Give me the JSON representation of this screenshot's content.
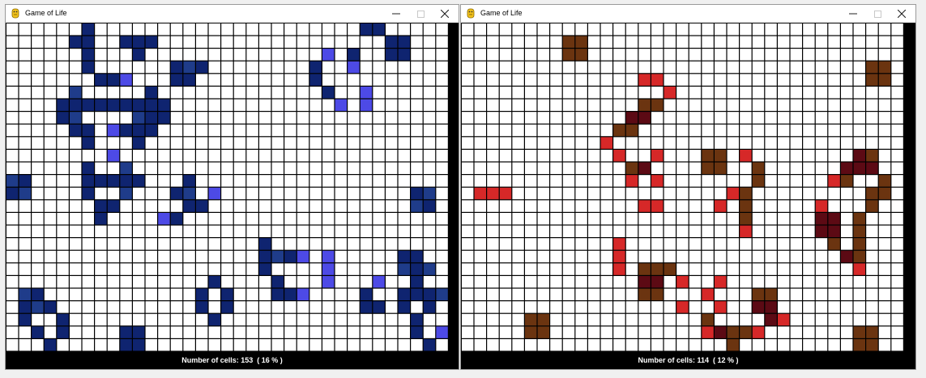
{
  "windows": [
    {
      "title": "Game of Life",
      "status": {
        "label": "Number of cells: ",
        "count": "153",
        "percent": "  ( 16 % )"
      },
      "colors": {
        "light": "#4d4ae6",
        "mid": "#1f3c8a",
        "dark": "#0f2470",
        "empty": "#ffffff",
        "gridline": "#000000"
      },
      "cells": [
        [
          6,
          0,
          "d"
        ],
        [
          28,
          0,
          "d"
        ],
        [
          29,
          0,
          "d"
        ],
        [
          5,
          1,
          "d"
        ],
        [
          6,
          1,
          "d"
        ],
        [
          9,
          1,
          "d"
        ],
        [
          10,
          1,
          "d"
        ],
        [
          11,
          1,
          "d"
        ],
        [
          30,
          1,
          "d"
        ],
        [
          31,
          1,
          "d"
        ],
        [
          6,
          2,
          "d"
        ],
        [
          10,
          2,
          "d"
        ],
        [
          25,
          2,
          "l"
        ],
        [
          27,
          2,
          "d"
        ],
        [
          30,
          2,
          "d"
        ],
        [
          31,
          2,
          "d"
        ],
        [
          6,
          3,
          "d"
        ],
        [
          13,
          3,
          "d"
        ],
        [
          14,
          3,
          "m"
        ],
        [
          15,
          3,
          "d"
        ],
        [
          24,
          3,
          "d"
        ],
        [
          27,
          3,
          "l"
        ],
        [
          7,
          4,
          "d"
        ],
        [
          8,
          4,
          "d"
        ],
        [
          9,
          4,
          "l"
        ],
        [
          13,
          4,
          "d"
        ],
        [
          14,
          4,
          "d"
        ],
        [
          24,
          4,
          "d"
        ],
        [
          5,
          5,
          "m"
        ],
        [
          11,
          5,
          "d"
        ],
        [
          25,
          5,
          "d"
        ],
        [
          28,
          5,
          "l"
        ],
        [
          4,
          6,
          "d"
        ],
        [
          5,
          6,
          "d"
        ],
        [
          6,
          6,
          "d"
        ],
        [
          7,
          6,
          "d"
        ],
        [
          8,
          6,
          "d"
        ],
        [
          9,
          6,
          "d"
        ],
        [
          10,
          6,
          "d"
        ],
        [
          11,
          6,
          "d"
        ],
        [
          12,
          6,
          "d"
        ],
        [
          26,
          6,
          "l"
        ],
        [
          28,
          6,
          "l"
        ],
        [
          4,
          7,
          "d"
        ],
        [
          5,
          7,
          "m"
        ],
        [
          10,
          7,
          "m"
        ],
        [
          11,
          7,
          "d"
        ],
        [
          12,
          7,
          "d"
        ],
        [
          5,
          8,
          "d"
        ],
        [
          6,
          8,
          "d"
        ],
        [
          8,
          8,
          "l"
        ],
        [
          9,
          8,
          "d"
        ],
        [
          10,
          8,
          "d"
        ],
        [
          11,
          8,
          "d"
        ],
        [
          6,
          9,
          "d"
        ],
        [
          10,
          9,
          "d"
        ],
        [
          8,
          10,
          "l"
        ],
        [
          6,
          11,
          "d"
        ],
        [
          9,
          11,
          "m"
        ],
        [
          0,
          12,
          "m"
        ],
        [
          1,
          12,
          "d"
        ],
        [
          6,
          12,
          "d"
        ],
        [
          7,
          12,
          "d"
        ],
        [
          8,
          12,
          "d"
        ],
        [
          9,
          12,
          "d"
        ],
        [
          10,
          12,
          "d"
        ],
        [
          14,
          12,
          "d"
        ],
        [
          0,
          13,
          "d"
        ],
        [
          1,
          13,
          "m"
        ],
        [
          6,
          13,
          "d"
        ],
        [
          9,
          13,
          "m"
        ],
        [
          13,
          13,
          "d"
        ],
        [
          14,
          13,
          "m"
        ],
        [
          16,
          13,
          "l"
        ],
        [
          32,
          13,
          "d"
        ],
        [
          33,
          13,
          "m"
        ],
        [
          7,
          14,
          "d"
        ],
        [
          8,
          14,
          "d"
        ],
        [
          14,
          14,
          "d"
        ],
        [
          15,
          14,
          "d"
        ],
        [
          32,
          14,
          "m"
        ],
        [
          33,
          14,
          "d"
        ],
        [
          7,
          15,
          "d"
        ],
        [
          12,
          15,
          "l"
        ],
        [
          13,
          15,
          "d"
        ],
        [
          20,
          17,
          "d"
        ],
        [
          20,
          18,
          "d"
        ],
        [
          21,
          18,
          "m"
        ],
        [
          22,
          18,
          "d"
        ],
        [
          23,
          18,
          "l"
        ],
        [
          25,
          18,
          "l"
        ],
        [
          31,
          18,
          "d"
        ],
        [
          32,
          18,
          "d"
        ],
        [
          20,
          19,
          "d"
        ],
        [
          25,
          19,
          "l"
        ],
        [
          31,
          19,
          "m"
        ],
        [
          32,
          19,
          "d"
        ],
        [
          33,
          19,
          "m"
        ],
        [
          16,
          20,
          "d"
        ],
        [
          21,
          20,
          "d"
        ],
        [
          25,
          20,
          "l"
        ],
        [
          29,
          20,
          "l"
        ],
        [
          32,
          20,
          "d"
        ],
        [
          1,
          21,
          "m"
        ],
        [
          2,
          21,
          "d"
        ],
        [
          15,
          21,
          "d"
        ],
        [
          17,
          21,
          "d"
        ],
        [
          21,
          21,
          "d"
        ],
        [
          22,
          21,
          "d"
        ],
        [
          23,
          21,
          "l"
        ],
        [
          28,
          21,
          "d"
        ],
        [
          31,
          21,
          "d"
        ],
        [
          32,
          21,
          "d"
        ],
        [
          33,
          21,
          "d"
        ],
        [
          34,
          21,
          "m"
        ],
        [
          1,
          22,
          "d"
        ],
        [
          2,
          22,
          "m"
        ],
        [
          3,
          22,
          "d"
        ],
        [
          15,
          22,
          "d"
        ],
        [
          17,
          22,
          "d"
        ],
        [
          28,
          22,
          "d"
        ],
        [
          29,
          22,
          "d"
        ],
        [
          31,
          22,
          "d"
        ],
        [
          33,
          22,
          "d"
        ],
        [
          1,
          23,
          "d"
        ],
        [
          4,
          23,
          "d"
        ],
        [
          16,
          23,
          "d"
        ],
        [
          32,
          23,
          "d"
        ],
        [
          2,
          24,
          "d"
        ],
        [
          4,
          24,
          "d"
        ],
        [
          9,
          24,
          "d"
        ],
        [
          10,
          24,
          "d"
        ],
        [
          32,
          24,
          "d"
        ],
        [
          34,
          24,
          "l"
        ],
        [
          3,
          25,
          "d"
        ],
        [
          9,
          25,
          "d"
        ],
        [
          10,
          25,
          "d"
        ],
        [
          33,
          25,
          "d"
        ]
      ]
    },
    {
      "title": "Game of Life",
      "status": {
        "label": "Number of cells: ",
        "count": "114",
        "percent": "  ( 12 % )"
      },
      "colors": {
        "light": "#d62828",
        "mid": "#6b3410",
        "dark": "#5c0a14",
        "empty": "#ffffff",
        "gridline": "#000000"
      },
      "cells": [
        [
          8,
          1,
          "m"
        ],
        [
          9,
          1,
          "m"
        ],
        [
          8,
          2,
          "m"
        ],
        [
          9,
          2,
          "m"
        ],
        [
          32,
          3,
          "m"
        ],
        [
          33,
          3,
          "m"
        ],
        [
          14,
          4,
          "l"
        ],
        [
          15,
          4,
          "l"
        ],
        [
          32,
          4,
          "m"
        ],
        [
          33,
          4,
          "m"
        ],
        [
          16,
          5,
          "l"
        ],
        [
          14,
          6,
          "m"
        ],
        [
          15,
          6,
          "m"
        ],
        [
          13,
          7,
          "d"
        ],
        [
          14,
          7,
          "d"
        ],
        [
          12,
          8,
          "m"
        ],
        [
          13,
          8,
          "m"
        ],
        [
          11,
          9,
          "l"
        ],
        [
          12,
          10,
          "l"
        ],
        [
          15,
          10,
          "l"
        ],
        [
          19,
          10,
          "m"
        ],
        [
          20,
          10,
          "m"
        ],
        [
          22,
          10,
          "l"
        ],
        [
          31,
          10,
          "d"
        ],
        [
          32,
          10,
          "m"
        ],
        [
          13,
          11,
          "m"
        ],
        [
          14,
          11,
          "d"
        ],
        [
          19,
          11,
          "m"
        ],
        [
          20,
          11,
          "m"
        ],
        [
          23,
          11,
          "m"
        ],
        [
          30,
          11,
          "d"
        ],
        [
          31,
          11,
          "d"
        ],
        [
          32,
          11,
          "d"
        ],
        [
          13,
          12,
          "l"
        ],
        [
          15,
          12,
          "l"
        ],
        [
          23,
          12,
          "m"
        ],
        [
          29,
          12,
          "l"
        ],
        [
          30,
          12,
          "m"
        ],
        [
          33,
          12,
          "m"
        ],
        [
          1,
          13,
          "l"
        ],
        [
          2,
          13,
          "l"
        ],
        [
          3,
          13,
          "l"
        ],
        [
          21,
          13,
          "l"
        ],
        [
          22,
          13,
          "m"
        ],
        [
          32,
          13,
          "m"
        ],
        [
          33,
          13,
          "m"
        ],
        [
          14,
          14,
          "l"
        ],
        [
          15,
          14,
          "l"
        ],
        [
          20,
          14,
          "l"
        ],
        [
          22,
          14,
          "m"
        ],
        [
          28,
          14,
          "l"
        ],
        [
          32,
          14,
          "m"
        ],
        [
          22,
          15,
          "m"
        ],
        [
          28,
          15,
          "d"
        ],
        [
          29,
          15,
          "d"
        ],
        [
          31,
          15,
          "m"
        ],
        [
          22,
          16,
          "l"
        ],
        [
          28,
          16,
          "d"
        ],
        [
          29,
          16,
          "d"
        ],
        [
          31,
          16,
          "m"
        ],
        [
          12,
          17,
          "l"
        ],
        [
          29,
          17,
          "m"
        ],
        [
          31,
          17,
          "m"
        ],
        [
          12,
          18,
          "l"
        ],
        [
          30,
          18,
          "d"
        ],
        [
          31,
          18,
          "m"
        ],
        [
          12,
          19,
          "l"
        ],
        [
          14,
          19,
          "m"
        ],
        [
          15,
          19,
          "m"
        ],
        [
          16,
          19,
          "m"
        ],
        [
          31,
          19,
          "l"
        ],
        [
          14,
          20,
          "d"
        ],
        [
          15,
          20,
          "d"
        ],
        [
          17,
          20,
          "l"
        ],
        [
          20,
          20,
          "l"
        ],
        [
          14,
          21,
          "m"
        ],
        [
          15,
          21,
          "m"
        ],
        [
          19,
          21,
          "l"
        ],
        [
          23,
          21,
          "m"
        ],
        [
          24,
          21,
          "m"
        ],
        [
          17,
          22,
          "l"
        ],
        [
          20,
          22,
          "l"
        ],
        [
          23,
          22,
          "d"
        ],
        [
          24,
          22,
          "d"
        ],
        [
          5,
          23,
          "m"
        ],
        [
          6,
          23,
          "m"
        ],
        [
          19,
          23,
          "m"
        ],
        [
          24,
          23,
          "d"
        ],
        [
          25,
          23,
          "l"
        ],
        [
          5,
          24,
          "m"
        ],
        [
          6,
          24,
          "m"
        ],
        [
          19,
          24,
          "l"
        ],
        [
          20,
          24,
          "d"
        ],
        [
          21,
          24,
          "m"
        ],
        [
          22,
          24,
          "m"
        ],
        [
          23,
          24,
          "l"
        ],
        [
          31,
          24,
          "m"
        ],
        [
          32,
          24,
          "m"
        ],
        [
          21,
          25,
          "m"
        ],
        [
          31,
          25,
          "m"
        ],
        [
          32,
          25,
          "m"
        ]
      ]
    }
  ]
}
